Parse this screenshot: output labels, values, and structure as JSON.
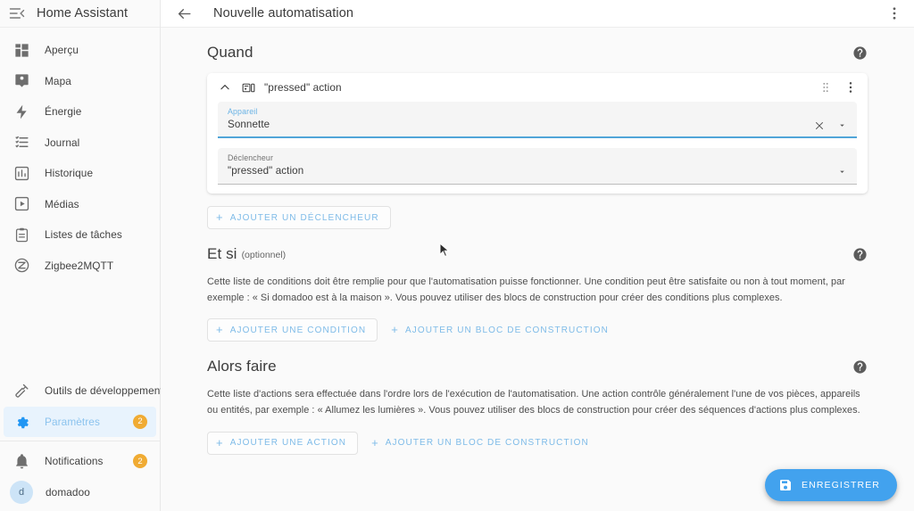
{
  "sidebar": {
    "title": "Home Assistant",
    "menu_icon": "menu-collapse-icon",
    "items": [
      {
        "label": "Aperçu",
        "icon": "view-dashboard-icon",
        "active": false,
        "badge": ""
      },
      {
        "label": "Mapa",
        "icon": "map-marker-icon",
        "active": false,
        "badge": ""
      },
      {
        "label": "Énergie",
        "icon": "lightning-bolt-icon",
        "active": false,
        "badge": ""
      },
      {
        "label": "Journal",
        "icon": "format-list-icon",
        "active": false,
        "badge": ""
      },
      {
        "label": "Historique",
        "icon": "chart-box-icon",
        "active": false,
        "badge": ""
      },
      {
        "label": "Médias",
        "icon": "play-box-icon",
        "active": false,
        "badge": ""
      },
      {
        "label": "Listes de tâches",
        "icon": "clipboard-list-icon",
        "active": false,
        "badge": ""
      },
      {
        "label": "Zigbee2MQTT",
        "icon": "zigbee-icon",
        "active": false,
        "badge": ""
      }
    ],
    "bottom_items": [
      {
        "label": "Outils de développement",
        "icon": "hammer-icon",
        "active": false,
        "badge": ""
      },
      {
        "label": "Paramètres",
        "icon": "cog-icon",
        "active": true,
        "badge": "2"
      }
    ],
    "footer_items": [
      {
        "label": "Notifications",
        "icon": "bell-icon",
        "badge": "2"
      }
    ],
    "user": {
      "label": "domadoo",
      "initial": "d"
    }
  },
  "topbar": {
    "back_icon": "arrow-left-icon",
    "title": "Nouvelle automatisation",
    "more_icon": "dots-vertical-icon"
  },
  "sections": {
    "when": {
      "title": "Quand",
      "optional": "",
      "help_icon": "help-circle-icon",
      "card": {
        "chevron_icon": "chevron-up-icon",
        "type_icon": "remote-device-icon",
        "title": "\"pressed\" action",
        "drag_icon": "drag-handle-icon",
        "more_icon": "dots-vertical-icon",
        "fields": [
          {
            "label": "Appareil",
            "value": "Sonnette",
            "active": true,
            "clear_icon": "close-icon",
            "dropdown_icon": "chevron-down-icon"
          },
          {
            "label": "Déclencheur",
            "value": "\"pressed\" action",
            "active": false,
            "clear_icon": "",
            "dropdown_icon": "chevron-down-icon"
          }
        ]
      },
      "buttons": [
        {
          "label": "AJOUTER UN DÉCLENCHEUR",
          "style": "outline",
          "plus": "+"
        }
      ]
    },
    "if": {
      "title": "Et si",
      "optional": "(optionnel)",
      "help_icon": "help-circle-icon",
      "description": "Cette liste de conditions doit être remplie pour que l'automatisation puisse fonctionner. Une condition peut être satisfaite ou non à tout moment, par exemple : « Si domadoo est à la maison ». Vous pouvez utiliser des blocs de construction pour créer des conditions plus complexes.",
      "buttons": [
        {
          "label": "AJOUTER UNE CONDITION",
          "style": "outline",
          "plus": "+"
        },
        {
          "label": "AJOUTER UN BLOC DE CONSTRUCTION",
          "style": "plain",
          "plus": "+"
        }
      ]
    },
    "then": {
      "title": "Alors faire",
      "optional": "",
      "help_icon": "help-circle-icon",
      "description": "Cette liste d'actions sera effectuée dans l'ordre lors de l'exécution de l'automatisation. Une action contrôle généralement l'une de vos pièces, appareils ou entités, par exemple : « Allumez les lumières ». Vous pouvez utiliser des blocs de construction pour créer des séquences d'actions plus complexes.",
      "buttons": [
        {
          "label": "AJOUTER UNE ACTION",
          "style": "outline",
          "plus": "+"
        },
        {
          "label": "AJOUTER UN BLOC DE CONSTRUCTION",
          "style": "plain",
          "plus": "+"
        }
      ]
    }
  },
  "fab": {
    "label": "ENREGISTRER",
    "icon": "content-save-icon",
    "color": "#42a2ee"
  },
  "colors": {
    "accent": "#42a2ee",
    "active_nav_bg": "#e8f3fd",
    "badge": "#f0ab33",
    "page_bg": "#fafafa"
  }
}
